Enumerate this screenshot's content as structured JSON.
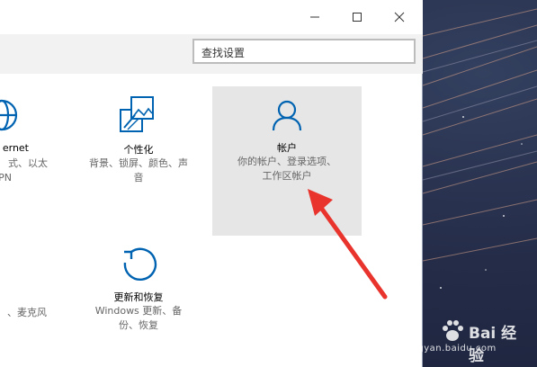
{
  "window": {
    "search_placeholder": "查找设置"
  },
  "tiles": {
    "network": {
      "title_partial": "ernet",
      "desc_line1": "式、以太",
      "desc_line2": "PN"
    },
    "personalization": {
      "title": "个性化",
      "desc_line1": "背景、锁屏、颜色、声",
      "desc_line2": "音"
    },
    "accounts": {
      "title": "帐户",
      "desc_line1": "你的帐户、登录选项、",
      "desc_line2": "工作区帐户"
    },
    "time_partial": {
      "desc_line1": "、麦克风"
    },
    "update": {
      "title": "更新和恢复",
      "desc_line1": "Windows 更新、备",
      "desc_line2": "份、恢复"
    }
  },
  "watermark": {
    "brand": "Bai 经验",
    "url": "jingyan.baidu.com"
  },
  "colors": {
    "accent": "#0063b1",
    "highlight_tile": "#e6e6e6",
    "arrow": "#e8342c"
  }
}
